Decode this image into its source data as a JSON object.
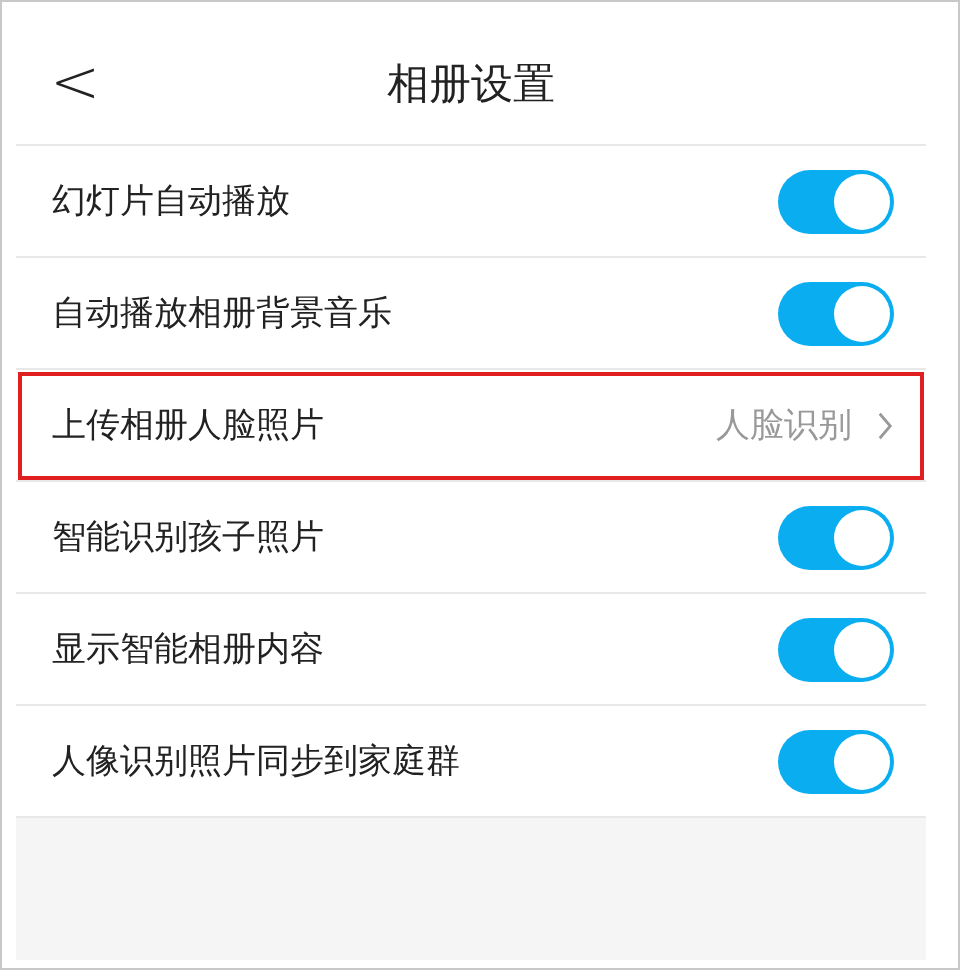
{
  "header": {
    "back_icon": "<",
    "title": "相册设置"
  },
  "settings": [
    {
      "kind": "toggle",
      "label": "幻灯片自动播放",
      "on": true,
      "highlighted": false
    },
    {
      "kind": "toggle",
      "label": "自动播放相册背景音乐",
      "on": true,
      "highlighted": false
    },
    {
      "kind": "link",
      "label": "上传相册人脸照片",
      "value": "人脸识别",
      "highlighted": true
    },
    {
      "kind": "toggle",
      "label": "智能识别孩子照片",
      "on": true,
      "highlighted": false
    },
    {
      "kind": "toggle",
      "label": "显示智能相册内容",
      "on": true,
      "highlighted": false
    },
    {
      "kind": "toggle",
      "label": "人像识别照片同步到家庭群",
      "on": true,
      "highlighted": false
    }
  ]
}
